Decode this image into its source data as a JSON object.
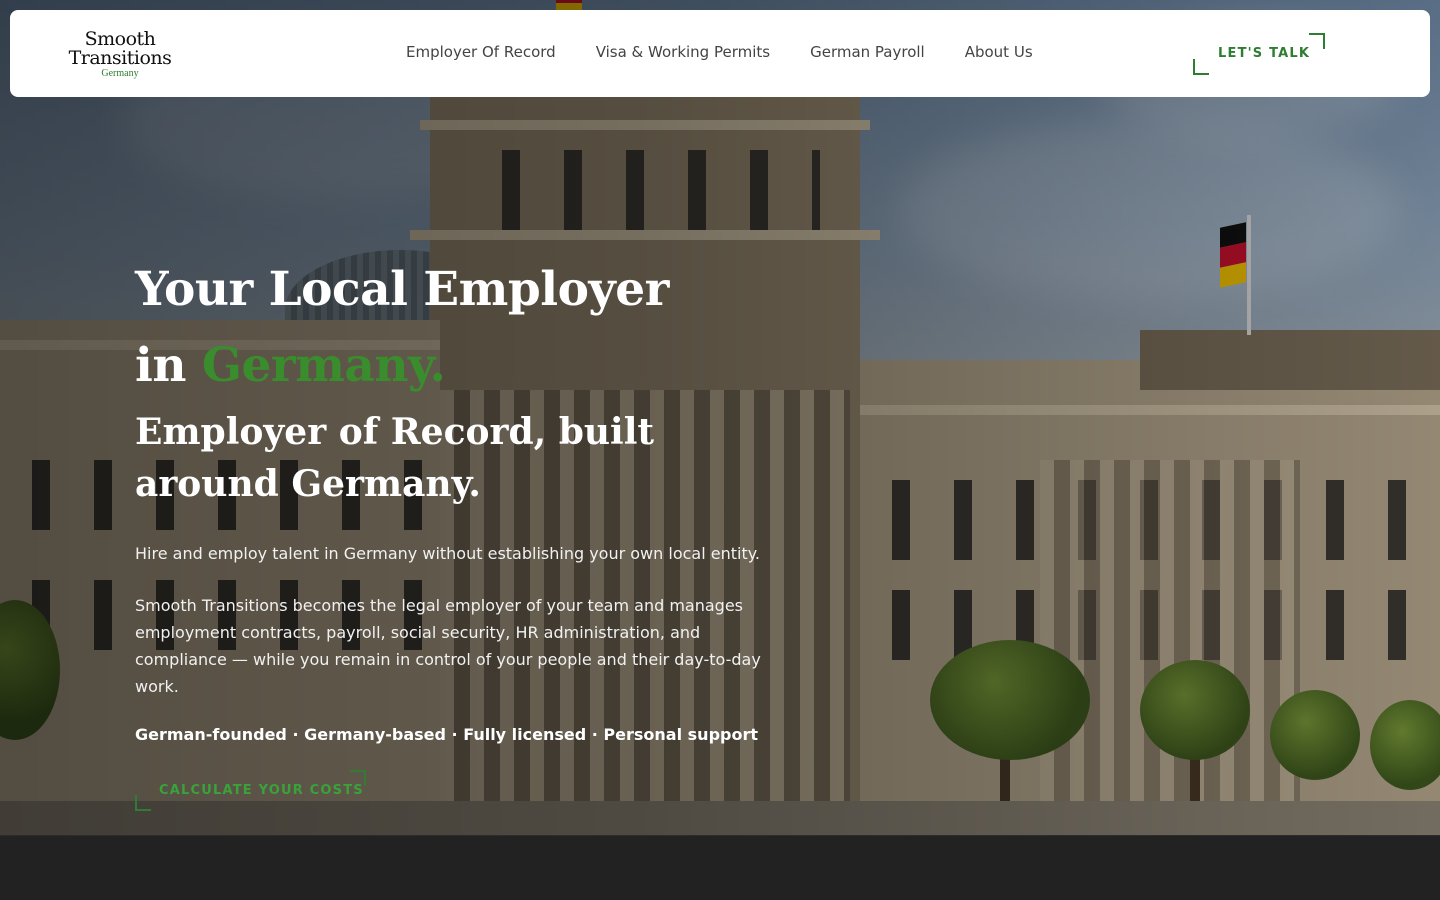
{
  "header": {
    "logo": {
      "line1": "Smooth",
      "line2": "Transitions",
      "line3": "Germany"
    },
    "nav": [
      {
        "label": "Employer Of Record"
      },
      {
        "label": "Visa & Working Permits"
      },
      {
        "label": "German Payroll"
      },
      {
        "label": "About Us"
      }
    ],
    "cta_label": "LET'S TALK"
  },
  "hero": {
    "title_line1": "Your Local Employer",
    "title_line2_prefix": "in ",
    "title_line2_accent": "Germany.",
    "subtitle": "Employer of Record, built around Germany.",
    "paragraph1": "Hire and employ talent in Germany without establishing your own local entity.",
    "paragraph2": "Smooth Transitions becomes the legal employer of your team and manages employment contracts, payroll, social security, HR administration, and compliance — while you remain in control of your people and their day-to-day work.",
    "tagline": "German-founded · Germany-based · Fully licensed · Personal support",
    "cta_label": "CALCULATE YOUR COSTS"
  },
  "colors": {
    "accent_green": "#2e7d32",
    "header_bg": "#ffffff",
    "footer_bg": "#222222"
  },
  "icons": [
    "german-flag"
  ]
}
